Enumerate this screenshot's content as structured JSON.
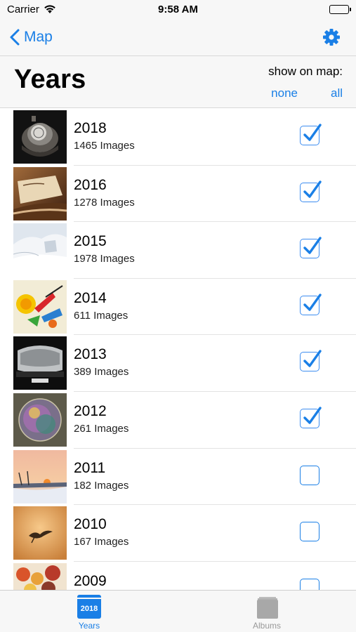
{
  "status": {
    "carrier": "Carrier",
    "time": "9:58 AM"
  },
  "nav": {
    "back_label": "Map"
  },
  "header": {
    "title": "Years",
    "show_on_map": "show on map:",
    "none": "none",
    "all": "all"
  },
  "rows": [
    {
      "year": "2018",
      "count": "1465 Images",
      "checked": true
    },
    {
      "year": "2016",
      "count": "1278 Images",
      "checked": true
    },
    {
      "year": "2015",
      "count": "1978 Images",
      "checked": true
    },
    {
      "year": "2014",
      "count": "611 Images",
      "checked": true
    },
    {
      "year": "2013",
      "count": "389 Images",
      "checked": true
    },
    {
      "year": "2012",
      "count": "261 Images",
      "checked": true
    },
    {
      "year": "2011",
      "count": "182 Images",
      "checked": false
    },
    {
      "year": "2010",
      "count": "167 Images",
      "checked": false
    },
    {
      "year": "2009",
      "count": "",
      "checked": false
    }
  ],
  "tabs": {
    "years": {
      "label": "Years",
      "icon_text": "2018",
      "icon": "calendar-year-icon"
    },
    "albums": {
      "label": "Albums",
      "icon": "albums-stack-icon"
    }
  },
  "colors": {
    "accent": "#1a7fe6",
    "bar_bg": "#f7f7f7"
  }
}
